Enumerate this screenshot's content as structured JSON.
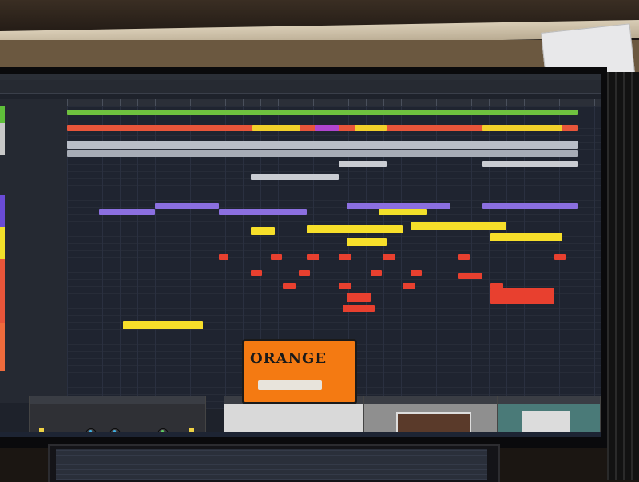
{
  "photo": {
    "description": "",
    "plugins": {
      "amp_logo": "ORANGE"
    }
  }
}
